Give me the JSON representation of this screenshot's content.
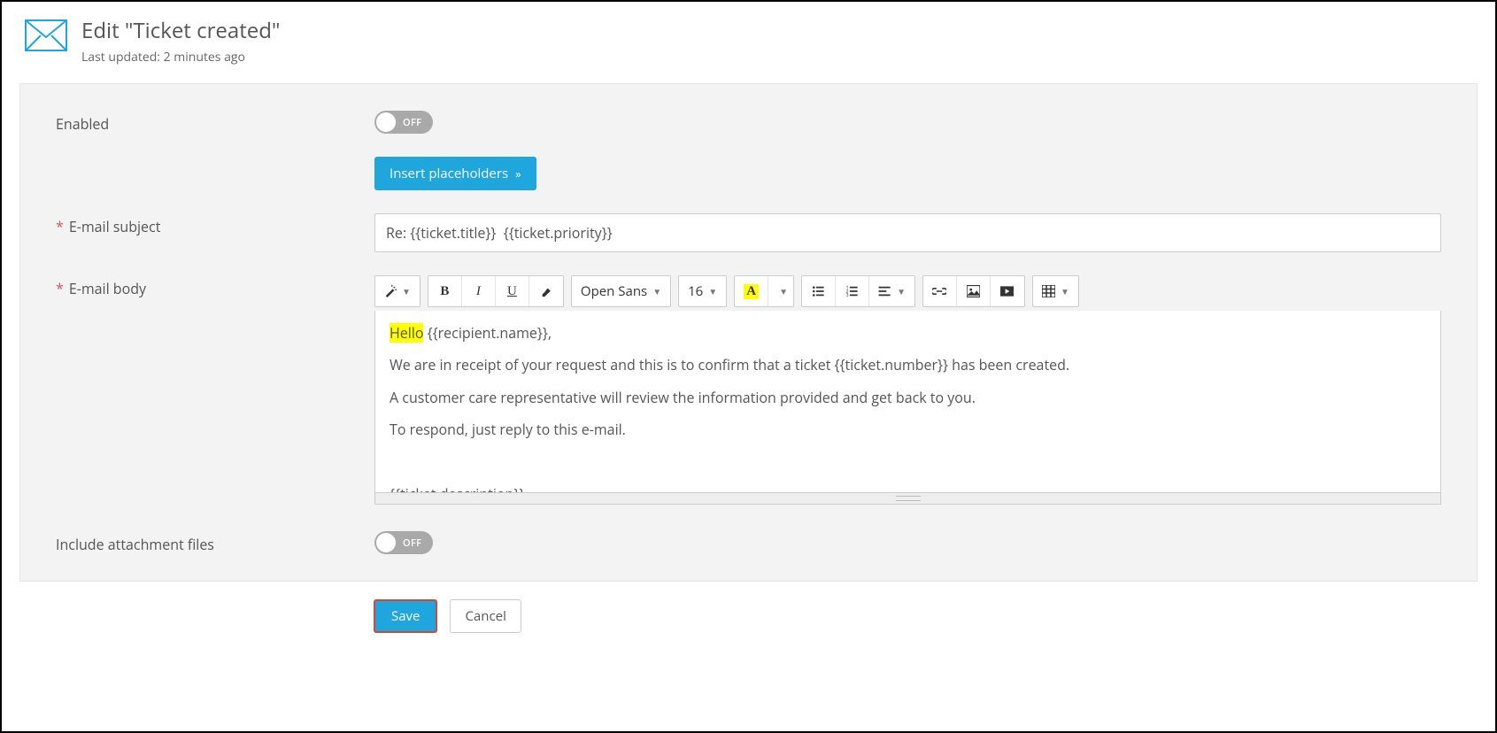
{
  "header": {
    "title": "Edit \"Ticket created\"",
    "subtitle": "Last updated: 2 minutes ago"
  },
  "fields": {
    "enabled_label": "Enabled",
    "enabled_toggle_text": "OFF",
    "insert_placeholders_label": "Insert placeholders",
    "subject_label": "E-mail subject",
    "subject_value": "Re: {{ticket.title}}  {{ticket.priority}}",
    "body_label": "E-mail body",
    "attachments_label": "Include attachment files",
    "attachments_toggle_text": "OFF"
  },
  "toolbar": {
    "font_name": "Open Sans",
    "font_size": "16"
  },
  "body_content": {
    "hl_word": "Hello",
    "rest_greeting": " {{recipient.name}},",
    "p2": "We are in receipt of your request and this is to confirm that a ticket {{ticket.number}} has been created.",
    "p3": "A customer care representative will review the information provided and get back to you.",
    "p4": "To respond, just reply to this e-mail.",
    "p5": "{{ticket.description}}"
  },
  "actions": {
    "save": "Save",
    "cancel": "Cancel"
  }
}
